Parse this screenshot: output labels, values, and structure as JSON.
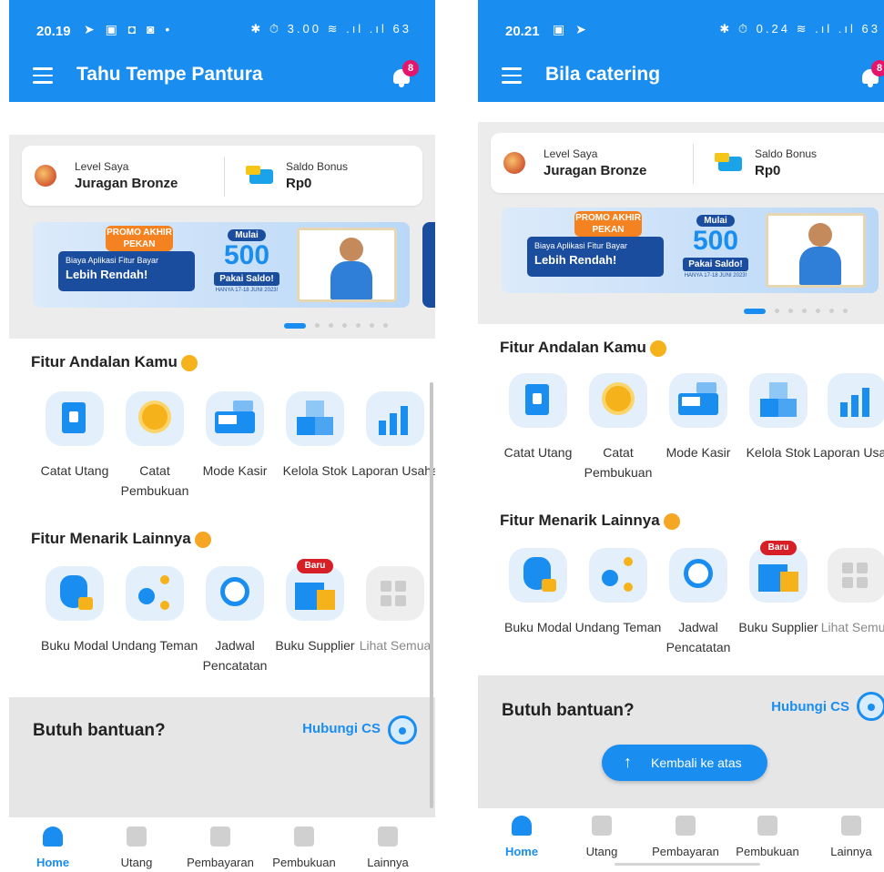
{
  "colors": {
    "primary": "#1a8df0",
    "badge": "#e5156b",
    "new_badge": "#d61f26",
    "section_bg": "#ececec"
  },
  "screens": [
    {
      "status": {
        "time": "20.19",
        "right_icons": "✱ ⏱ 3.00 ≋ .ıl .ıl 63"
      },
      "appbar": {
        "title": "Tahu Tempe Pantura",
        "notif_count": "8"
      },
      "level": {
        "label": "Level Saya",
        "value": "Juragan Bronze"
      },
      "bonus": {
        "label": "Saldo Bonus",
        "value": "Rp0"
      },
      "banner": {
        "tag": "PROMO AKHIR PEKAN",
        "line1": "Biaya Aplikasi Fitur Bayar",
        "line2": "Lebih Rendah!",
        "mulai": "Mulai",
        "amount": "500",
        "pakai": "Pakai Saldo!",
        "date": "HANYA 17-18 JUNI 2023!"
      },
      "section1": "Fitur Andalan Kamu",
      "featured": [
        {
          "label": "Catat Utang",
          "icon": "book-icon"
        },
        {
          "label": "Catat Pembukuan",
          "icon": "coin-cycle-icon"
        },
        {
          "label": "Mode Kasir",
          "icon": "cash-register-icon"
        },
        {
          "label": "Kelola Stok",
          "icon": "boxes-icon"
        },
        {
          "label": "Laporan Usaha",
          "icon": "report-chart-icon"
        }
      ],
      "section2": "Fitur Menarik Lainnya",
      "others": [
        {
          "label": "Buku Modal",
          "icon": "money-bag-icon"
        },
        {
          "label": "Undang Teman",
          "icon": "invite-icon"
        },
        {
          "label": "Jadwal Pencatatan",
          "icon": "alarm-clock-icon"
        },
        {
          "label": "Buku Supplier",
          "icon": "supplier-icon",
          "badge": "Baru"
        },
        {
          "label": "Lihat Semua",
          "icon": "grid-icon"
        }
      ],
      "help": {
        "title": "Butuh bantuan?",
        "cs": "Hubungi CS"
      },
      "nav": [
        "Home",
        "Utang",
        "Pembayaran",
        "Pembukuan",
        "Lainnya"
      ]
    },
    {
      "status": {
        "time": "20.21",
        "right_icons": "✱ ⏱ 0.24 ≋ .ıl .ıl 63"
      },
      "appbar": {
        "title": "Bila catering",
        "notif_count": "8"
      },
      "level": {
        "label": "Level Saya",
        "value": "Juragan Bronze"
      },
      "bonus": {
        "label": "Saldo Bonus",
        "value": "Rp0"
      },
      "banner": {
        "tag": "PROMO AKHIR PEKAN",
        "line1": "Biaya Aplikasi Fitur Bayar",
        "line2": "Lebih Rendah!",
        "mulai": "Mulai",
        "amount": "500",
        "pakai": "Pakai Saldo!",
        "date": "HANYA 17-18 JUNI 2023!"
      },
      "section1": "Fitur Andalan Kamu",
      "featured": [
        {
          "label": "Catat Utang",
          "icon": "book-icon"
        },
        {
          "label": "Catat Pembukuan",
          "icon": "coin-cycle-icon"
        },
        {
          "label": "Mode Kasir",
          "icon": "cash-register-icon"
        },
        {
          "label": "Kelola Stok",
          "icon": "boxes-icon"
        },
        {
          "label": "Laporan Usaha",
          "icon": "report-chart-icon"
        }
      ],
      "section2": "Fitur Menarik Lainnya",
      "others": [
        {
          "label": "Buku Modal",
          "icon": "money-bag-icon"
        },
        {
          "label": "Undang Teman",
          "icon": "invite-icon"
        },
        {
          "label": "Jadwal Pencatatan",
          "icon": "alarm-clock-icon"
        },
        {
          "label": "Buku Supplier",
          "icon": "supplier-icon",
          "badge": "Baru"
        },
        {
          "label": "Lihat Semua",
          "icon": "grid-icon"
        }
      ],
      "help": {
        "title": "Butuh bantuan?",
        "cs": "Hubungi CS"
      },
      "scroll_top": "Kembali ke atas",
      "nav": [
        "Home",
        "Utang",
        "Pembayaran",
        "Pembukuan",
        "Lainnya"
      ]
    }
  ]
}
